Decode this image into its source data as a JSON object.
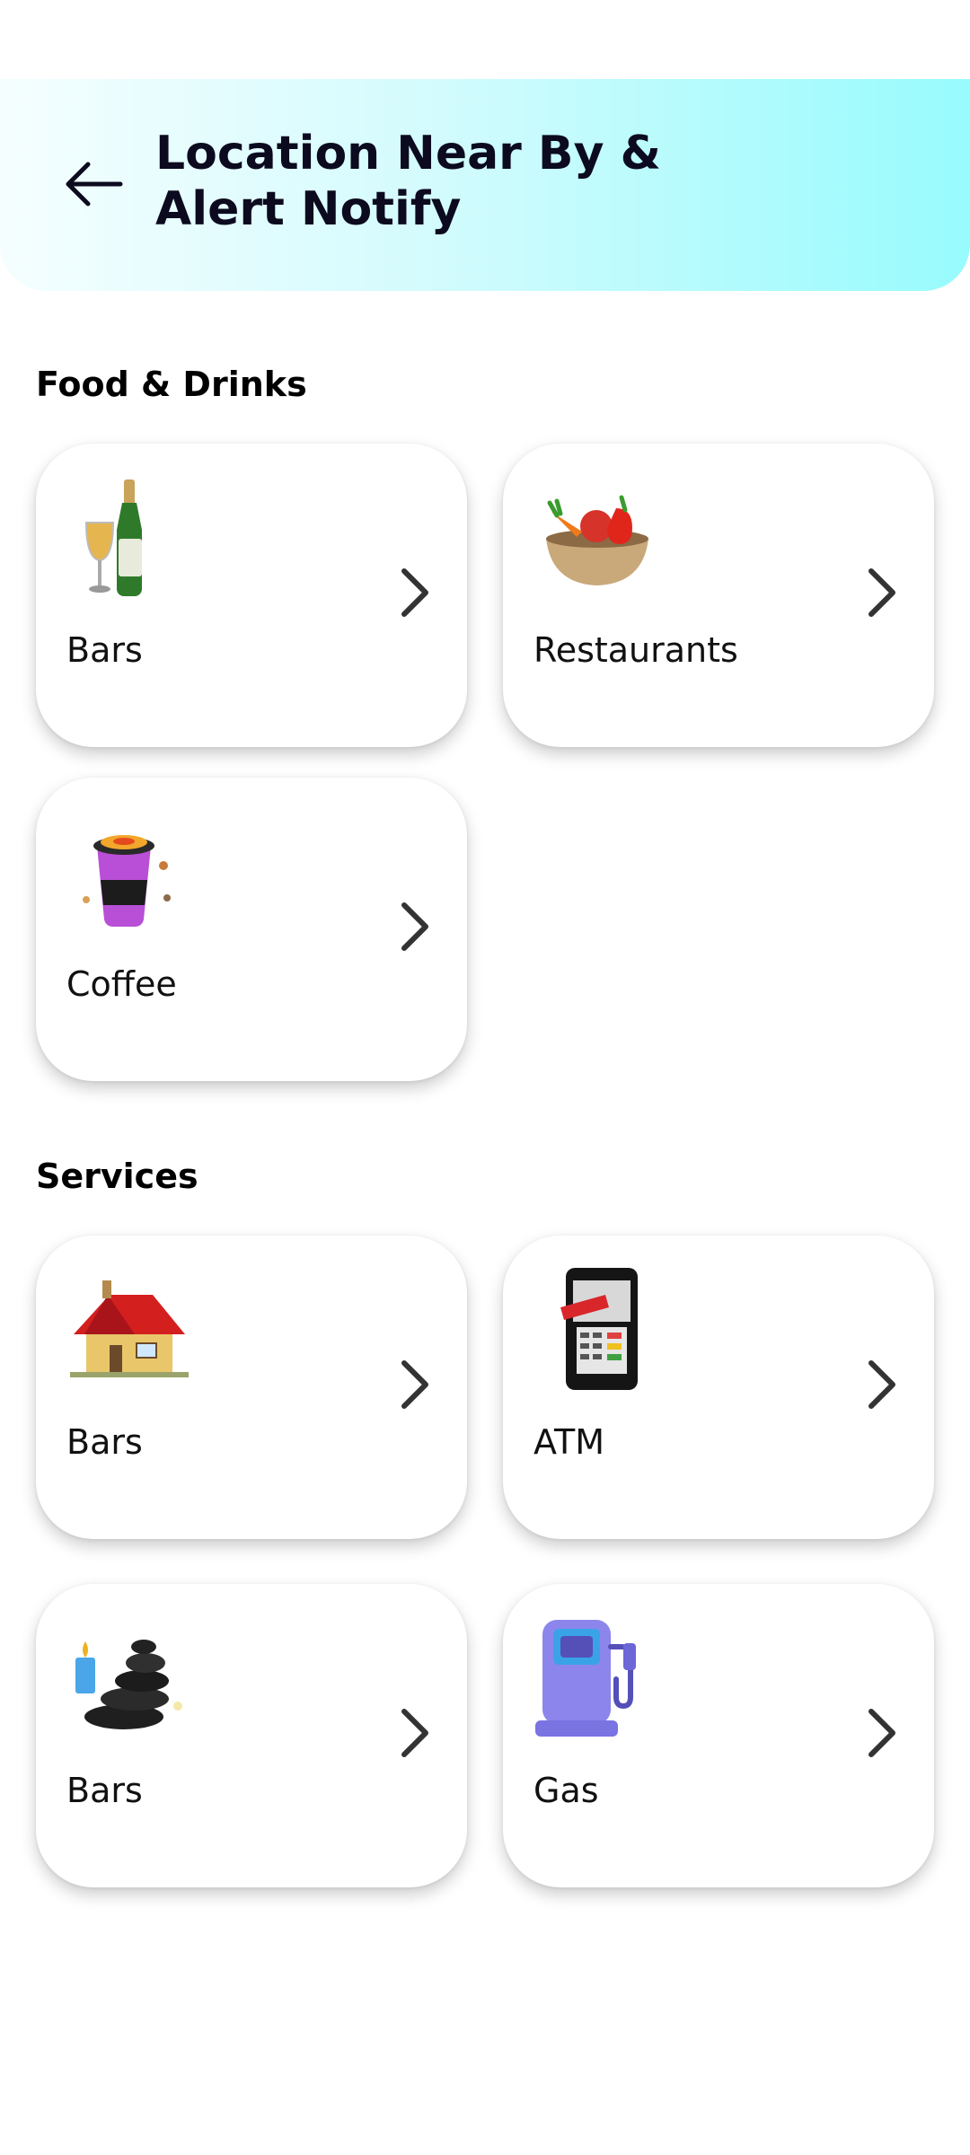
{
  "header": {
    "title": "Location Near By &\nAlert Notify",
    "back_icon": "arrow-left-icon",
    "gradient_start": "#f5feff",
    "gradient_end": "#97fbfd"
  },
  "sections": [
    {
      "title": "Food & Drinks",
      "cards": [
        {
          "label": "Bars",
          "icon": "champagne-bottle-icon"
        },
        {
          "label": "Restaurants",
          "icon": "vegetable-bowl-icon"
        },
        {
          "label": "Coffee",
          "icon": "coffee-cup-icon"
        }
      ]
    },
    {
      "title": "Services",
      "cards": [
        {
          "label": "Bars",
          "icon": "house-icon"
        },
        {
          "label": "ATM",
          "icon": "atm-phone-icon"
        },
        {
          "label": "Bars",
          "icon": "spa-stones-icon"
        },
        {
          "label": "Gas",
          "icon": "gas-pump-icon"
        }
      ]
    }
  ],
  "colors": {
    "chevron": "#333333",
    "card_bg": "#ffffff"
  }
}
